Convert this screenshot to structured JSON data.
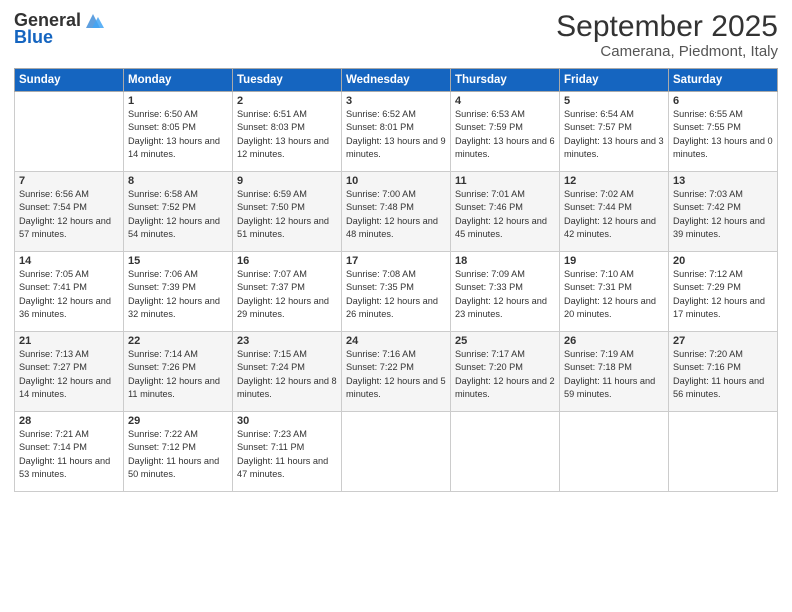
{
  "header": {
    "logo_general": "General",
    "logo_blue": "Blue",
    "month": "September 2025",
    "location": "Camerana, Piedmont, Italy"
  },
  "weekdays": [
    "Sunday",
    "Monday",
    "Tuesday",
    "Wednesday",
    "Thursday",
    "Friday",
    "Saturday"
  ],
  "weeks": [
    [
      {
        "day": "",
        "sunrise": "",
        "sunset": "",
        "daylight": ""
      },
      {
        "day": "1",
        "sunrise": "Sunrise: 6:50 AM",
        "sunset": "Sunset: 8:05 PM",
        "daylight": "Daylight: 13 hours and 14 minutes."
      },
      {
        "day": "2",
        "sunrise": "Sunrise: 6:51 AM",
        "sunset": "Sunset: 8:03 PM",
        "daylight": "Daylight: 13 hours and 12 minutes."
      },
      {
        "day": "3",
        "sunrise": "Sunrise: 6:52 AM",
        "sunset": "Sunset: 8:01 PM",
        "daylight": "Daylight: 13 hours and 9 minutes."
      },
      {
        "day": "4",
        "sunrise": "Sunrise: 6:53 AM",
        "sunset": "Sunset: 7:59 PM",
        "daylight": "Daylight: 13 hours and 6 minutes."
      },
      {
        "day": "5",
        "sunrise": "Sunrise: 6:54 AM",
        "sunset": "Sunset: 7:57 PM",
        "daylight": "Daylight: 13 hours and 3 minutes."
      },
      {
        "day": "6",
        "sunrise": "Sunrise: 6:55 AM",
        "sunset": "Sunset: 7:55 PM",
        "daylight": "Daylight: 13 hours and 0 minutes."
      }
    ],
    [
      {
        "day": "7",
        "sunrise": "Sunrise: 6:56 AM",
        "sunset": "Sunset: 7:54 PM",
        "daylight": "Daylight: 12 hours and 57 minutes."
      },
      {
        "day": "8",
        "sunrise": "Sunrise: 6:58 AM",
        "sunset": "Sunset: 7:52 PM",
        "daylight": "Daylight: 12 hours and 54 minutes."
      },
      {
        "day": "9",
        "sunrise": "Sunrise: 6:59 AM",
        "sunset": "Sunset: 7:50 PM",
        "daylight": "Daylight: 12 hours and 51 minutes."
      },
      {
        "day": "10",
        "sunrise": "Sunrise: 7:00 AM",
        "sunset": "Sunset: 7:48 PM",
        "daylight": "Daylight: 12 hours and 48 minutes."
      },
      {
        "day": "11",
        "sunrise": "Sunrise: 7:01 AM",
        "sunset": "Sunset: 7:46 PM",
        "daylight": "Daylight: 12 hours and 45 minutes."
      },
      {
        "day": "12",
        "sunrise": "Sunrise: 7:02 AM",
        "sunset": "Sunset: 7:44 PM",
        "daylight": "Daylight: 12 hours and 42 minutes."
      },
      {
        "day": "13",
        "sunrise": "Sunrise: 7:03 AM",
        "sunset": "Sunset: 7:42 PM",
        "daylight": "Daylight: 12 hours and 39 minutes."
      }
    ],
    [
      {
        "day": "14",
        "sunrise": "Sunrise: 7:05 AM",
        "sunset": "Sunset: 7:41 PM",
        "daylight": "Daylight: 12 hours and 36 minutes."
      },
      {
        "day": "15",
        "sunrise": "Sunrise: 7:06 AM",
        "sunset": "Sunset: 7:39 PM",
        "daylight": "Daylight: 12 hours and 32 minutes."
      },
      {
        "day": "16",
        "sunrise": "Sunrise: 7:07 AM",
        "sunset": "Sunset: 7:37 PM",
        "daylight": "Daylight: 12 hours and 29 minutes."
      },
      {
        "day": "17",
        "sunrise": "Sunrise: 7:08 AM",
        "sunset": "Sunset: 7:35 PM",
        "daylight": "Daylight: 12 hours and 26 minutes."
      },
      {
        "day": "18",
        "sunrise": "Sunrise: 7:09 AM",
        "sunset": "Sunset: 7:33 PM",
        "daylight": "Daylight: 12 hours and 23 minutes."
      },
      {
        "day": "19",
        "sunrise": "Sunrise: 7:10 AM",
        "sunset": "Sunset: 7:31 PM",
        "daylight": "Daylight: 12 hours and 20 minutes."
      },
      {
        "day": "20",
        "sunrise": "Sunrise: 7:12 AM",
        "sunset": "Sunset: 7:29 PM",
        "daylight": "Daylight: 12 hours and 17 minutes."
      }
    ],
    [
      {
        "day": "21",
        "sunrise": "Sunrise: 7:13 AM",
        "sunset": "Sunset: 7:27 PM",
        "daylight": "Daylight: 12 hours and 14 minutes."
      },
      {
        "day": "22",
        "sunrise": "Sunrise: 7:14 AM",
        "sunset": "Sunset: 7:26 PM",
        "daylight": "Daylight: 12 hours and 11 minutes."
      },
      {
        "day": "23",
        "sunrise": "Sunrise: 7:15 AM",
        "sunset": "Sunset: 7:24 PM",
        "daylight": "Daylight: 12 hours and 8 minutes."
      },
      {
        "day": "24",
        "sunrise": "Sunrise: 7:16 AM",
        "sunset": "Sunset: 7:22 PM",
        "daylight": "Daylight: 12 hours and 5 minutes."
      },
      {
        "day": "25",
        "sunrise": "Sunrise: 7:17 AM",
        "sunset": "Sunset: 7:20 PM",
        "daylight": "Daylight: 12 hours and 2 minutes."
      },
      {
        "day": "26",
        "sunrise": "Sunrise: 7:19 AM",
        "sunset": "Sunset: 7:18 PM",
        "daylight": "Daylight: 11 hours and 59 minutes."
      },
      {
        "day": "27",
        "sunrise": "Sunrise: 7:20 AM",
        "sunset": "Sunset: 7:16 PM",
        "daylight": "Daylight: 11 hours and 56 minutes."
      }
    ],
    [
      {
        "day": "28",
        "sunrise": "Sunrise: 7:21 AM",
        "sunset": "Sunset: 7:14 PM",
        "daylight": "Daylight: 11 hours and 53 minutes."
      },
      {
        "day": "29",
        "sunrise": "Sunrise: 7:22 AM",
        "sunset": "Sunset: 7:12 PM",
        "daylight": "Daylight: 11 hours and 50 minutes."
      },
      {
        "day": "30",
        "sunrise": "Sunrise: 7:23 AM",
        "sunset": "Sunset: 7:11 PM",
        "daylight": "Daylight: 11 hours and 47 minutes."
      },
      {
        "day": "",
        "sunrise": "",
        "sunset": "",
        "daylight": ""
      },
      {
        "day": "",
        "sunrise": "",
        "sunset": "",
        "daylight": ""
      },
      {
        "day": "",
        "sunrise": "",
        "sunset": "",
        "daylight": ""
      },
      {
        "day": "",
        "sunrise": "",
        "sunset": "",
        "daylight": ""
      }
    ]
  ]
}
